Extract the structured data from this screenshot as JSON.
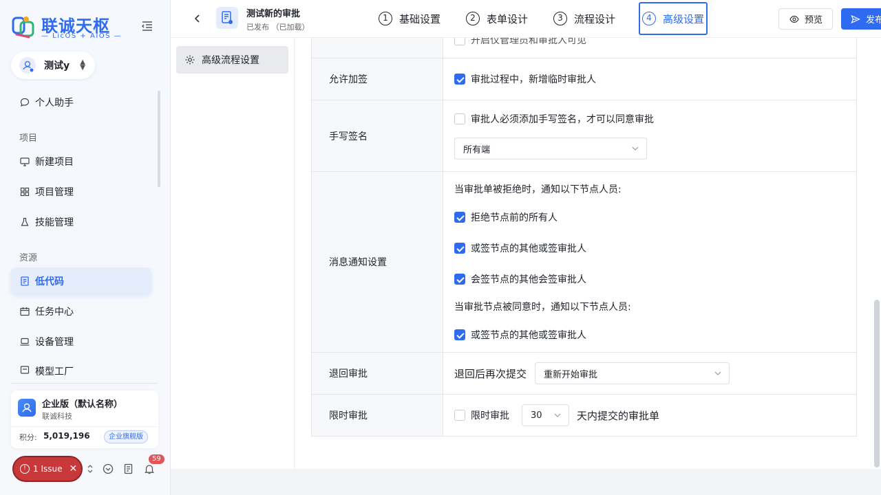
{
  "brand": {
    "title": "联诚天枢",
    "subtitle": "— LicOS + AIOS —"
  },
  "workspace": {
    "name": "测试y"
  },
  "sidebar": {
    "assistant": "个人助手",
    "section_project": "项目",
    "new_project": "新建项目",
    "project_manage": "项目管理",
    "skill_manage": "技能管理",
    "section_resource": "资源",
    "lowcode": "低代码",
    "task_center": "任务中心",
    "device_manage": "设备管理",
    "model_factory": "模型工厂"
  },
  "org": {
    "name": "企业版（默认名称）",
    "company": "联诚科技",
    "points_label": "积分:",
    "points_value": "5,019,196",
    "badge": "企业旗舰版"
  },
  "issue": {
    "label": "1 Issue"
  },
  "notifications": {
    "count": "59"
  },
  "header": {
    "form_title": "测试新的审批",
    "form_status": "已发布  （已加载）",
    "steps": [
      {
        "num": "1",
        "label": "基础设置"
      },
      {
        "num": "2",
        "label": "表单设计"
      },
      {
        "num": "3",
        "label": "流程设计"
      },
      {
        "num": "4",
        "label": "高级设置"
      }
    ],
    "preview_label": "预览",
    "publish_label": "发布"
  },
  "left_panel": {
    "item": "高级流程设置"
  },
  "settings": {
    "top_partial_text": "开启仅管理员和审批人可见",
    "add_sign": {
      "label": "允许加签",
      "option": "审批过程中，新增临时审批人",
      "checked": true
    },
    "handwrite": {
      "label": "手写签名",
      "option": "审批人必须添加手写签名，才可以同意审批",
      "checked": false,
      "select_value": "所有端"
    },
    "notify": {
      "label": "消息通知设置",
      "reject_title": "当审批单被拒绝时，通知以下节点人员:",
      "reject_options": [
        "拒绝节点前的所有人",
        "或签节点的其他或签审批人",
        "会签节点的其他会签审批人"
      ],
      "approve_title": "当审批节点被同意时，通知以下节点人员:",
      "approve_options": [
        "或签节点的其他或签审批人"
      ]
    },
    "return": {
      "label": "退回审批",
      "prefix": "退回后再次提交",
      "select_value": "重新开始审批"
    },
    "timelimit": {
      "label": "限时审批",
      "option": "限时审批",
      "checked": false,
      "days": "30",
      "suffix": "天内提交的审批单"
    }
  },
  "colors": {
    "accent": "#2f6bf0",
    "issue": "#c8383b",
    "badge": "#e0555a"
  }
}
